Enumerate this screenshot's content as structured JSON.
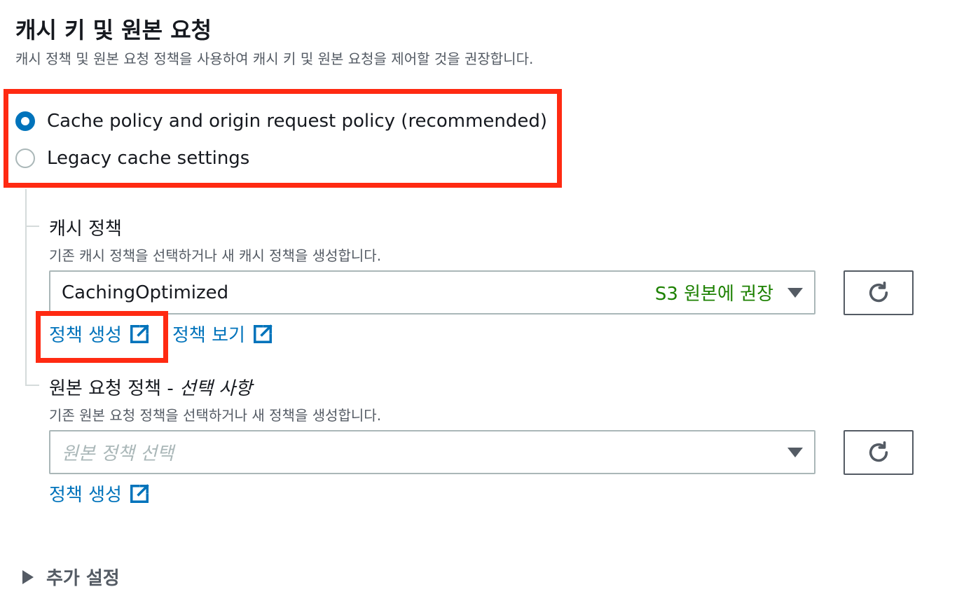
{
  "section": {
    "title": "캐시 키 및 원본 요청",
    "description": "캐시 정책 및 원본 요청 정책을 사용하여 캐시 키 및 원본 요청을 제어할 것을 권장합니다."
  },
  "radio_options": [
    {
      "label": "Cache policy and origin request policy (recommended)",
      "checked": true
    },
    {
      "label": "Legacy cache settings",
      "checked": false
    }
  ],
  "cache_policy": {
    "label": "캐시 정책",
    "description": "기존 캐시 정책을 선택하거나 새 캐시 정책을 생성합니다.",
    "selected_value": "CachingOptimized",
    "selected_tag": "S3 원본에 권장",
    "create_link": "정책 생성",
    "view_link": "정책 보기"
  },
  "origin_request_policy": {
    "label": "원본 요청 정책 - ",
    "label_optional": "선택 사항",
    "description": "기존 원본 요청 정책을 선택하거나 새 정책을 생성합니다.",
    "placeholder": "원본 정책 선택",
    "create_link": "정책 생성"
  },
  "additional_settings": {
    "label": "추가 설정"
  },
  "colors": {
    "accent": "#0073bb",
    "highlight": "#ff2a12",
    "recommended_tag": "#1d8102"
  },
  "icons": {
    "refresh": "refresh-icon",
    "external_link": "external-link-icon",
    "caret": "caret-down-icon",
    "expand": "caret-right-icon"
  }
}
